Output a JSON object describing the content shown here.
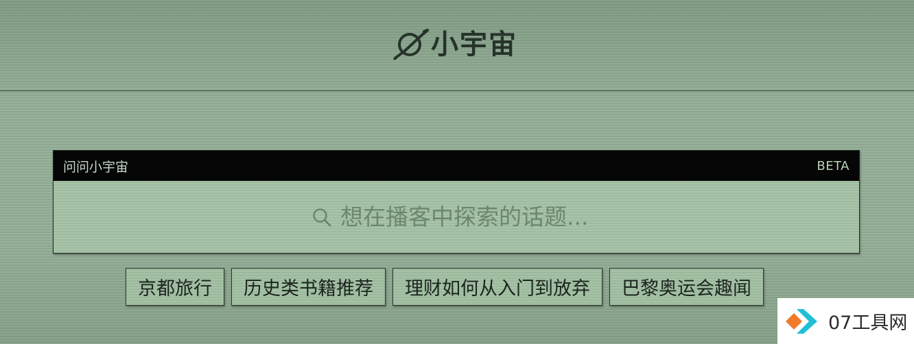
{
  "brand": {
    "name": "小宇宙"
  },
  "ask": {
    "title": "问问小宇宙",
    "badge": "BETA",
    "placeholder": "想在播客中探索的话题..."
  },
  "suggestions": [
    {
      "label": "京都旅行"
    },
    {
      "label": "历史类书籍推荐"
    },
    {
      "label": "理财如何从入门到放弃"
    },
    {
      "label": "巴黎奥运会趣闻"
    }
  ],
  "watermark": {
    "text": "07工具网"
  },
  "colors": {
    "background": "#8fa891",
    "panel": "#a3c1a5",
    "bar": "#050605",
    "text_dark": "#1b241d",
    "watermark_orange": "#f07a2a",
    "watermark_cyan": "#1fc0d6"
  },
  "icons": {
    "brand": "planet-icon",
    "search": "search-icon",
    "watermark": "watermark-logo-icon"
  }
}
